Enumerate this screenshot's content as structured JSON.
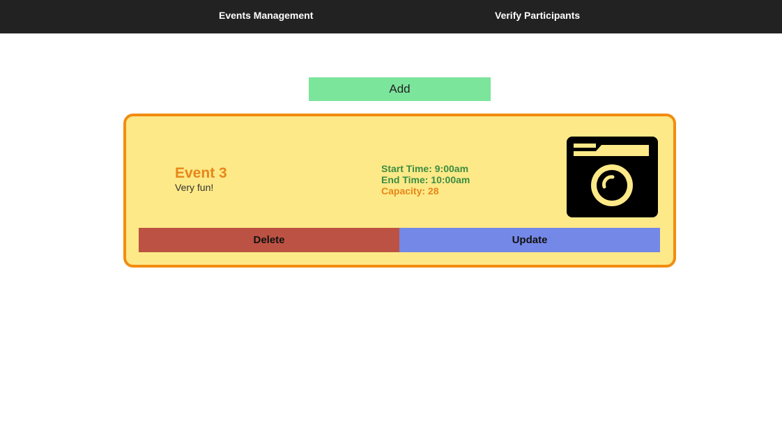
{
  "navbar": {
    "links": [
      {
        "label": "Events Management"
      },
      {
        "label": "Verify Participants"
      }
    ]
  },
  "add_button": {
    "label": "Add"
  },
  "event": {
    "title": "Event 3",
    "description": "Very fun!",
    "start_time": "Start Time: 9:00am",
    "end_time": "End Time: 10:00am",
    "capacity": "Capacity: 28",
    "image_icon": "camera-icon",
    "delete_label": "Delete",
    "update_label": "Update"
  },
  "colors": {
    "navbar_bg": "#222222",
    "add_button_bg": "#7ce59c",
    "card_bg": "#fde987",
    "card_border": "#f28c11",
    "title": "#e7861a",
    "time_text": "#3b8c43",
    "delete_bg": "#bc5243",
    "update_bg": "#7488e8"
  }
}
